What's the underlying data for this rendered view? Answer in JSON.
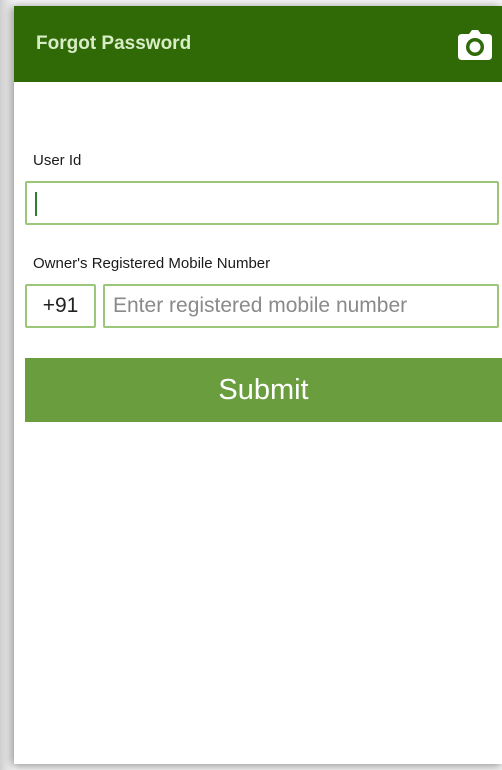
{
  "app_bar": {
    "title": "Forgot Password",
    "action_icon": "camera-icon",
    "color": "#2f6a07",
    "title_color": "#d8ecc5"
  },
  "form": {
    "user_id": {
      "label": "User Id",
      "value": ""
    },
    "mobile": {
      "label": "Owner's Registered Mobile Number",
      "country_code": "+91",
      "value": "",
      "placeholder": "Enter registered mobile number"
    },
    "submit_label": "Submit",
    "submit_color": "#6a9d3e",
    "field_border_color": "#9cc67a"
  }
}
